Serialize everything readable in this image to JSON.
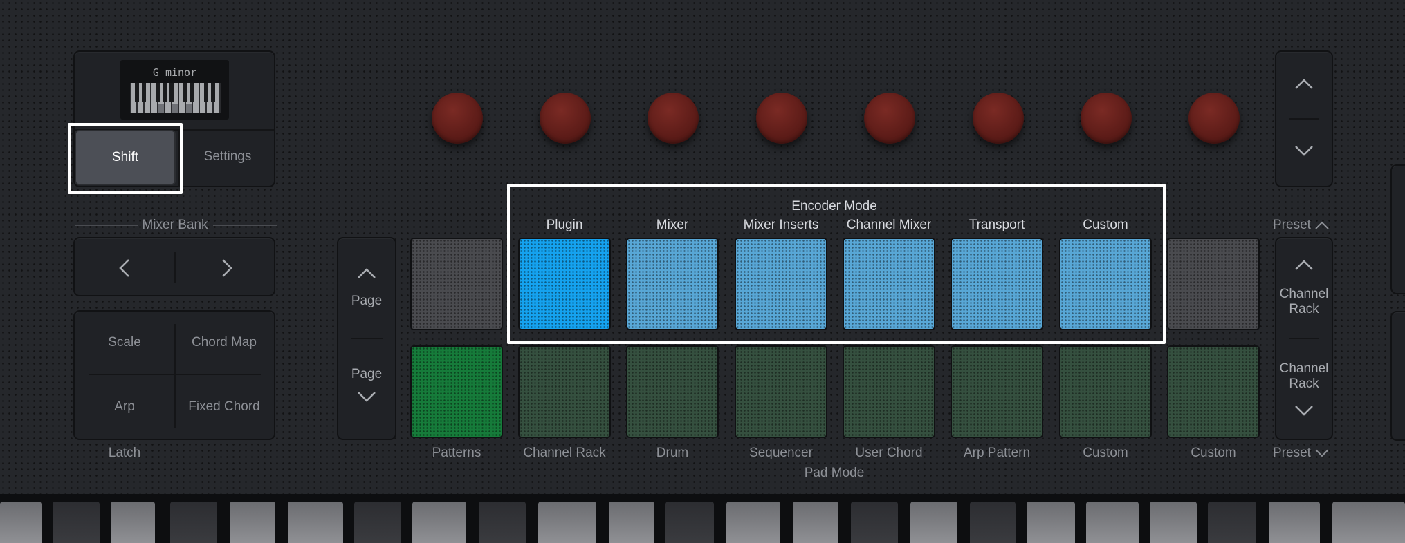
{
  "screen": {
    "text": "G minor"
  },
  "top_left": {
    "shift_label": "Shift",
    "settings_label": "Settings"
  },
  "mixer_bank": {
    "label": "Mixer Bank"
  },
  "function_buttons": {
    "scale": "Scale",
    "chord_map": "Chord Map",
    "arp": "Arp",
    "fixed_chord": "Fixed Chord",
    "latch": "Latch"
  },
  "page": {
    "up_label": "Page",
    "down_label": "Page"
  },
  "encoder_mode": {
    "title": "Encoder Mode",
    "modes": [
      "Plugin",
      "Mixer",
      "Mixer Inserts",
      "Channel Mixer",
      "Transport",
      "Custom"
    ]
  },
  "pad_mode": {
    "title": "Pad Mode",
    "labels": [
      "Patterns",
      "Channel Rack",
      "Drum",
      "Sequencer",
      "User Chord",
      "Arp Pattern",
      "Custom",
      "Custom"
    ]
  },
  "right": {
    "preset_up": "Preset",
    "preset_down": "Preset",
    "channel_rack_up_1": "Channel",
    "channel_rack_up_2": "Rack",
    "channel_rack_down_1": "Channel",
    "channel_rack_down_2": "Rack"
  },
  "colors": {
    "knob": "#5f1d19",
    "pad_blue": "#58a7d6",
    "pad_blue_active": "#15a2ef",
    "pad_green": "#35503f",
    "pad_green_active": "#167b3a",
    "pad_gray": "#4a4b4f",
    "highlight": "#ffffff"
  },
  "icons": [
    "chevron-left-icon",
    "chevron-right-icon",
    "chevron-up-icon",
    "chevron-down-icon",
    "piano-keyboard-icon"
  ]
}
